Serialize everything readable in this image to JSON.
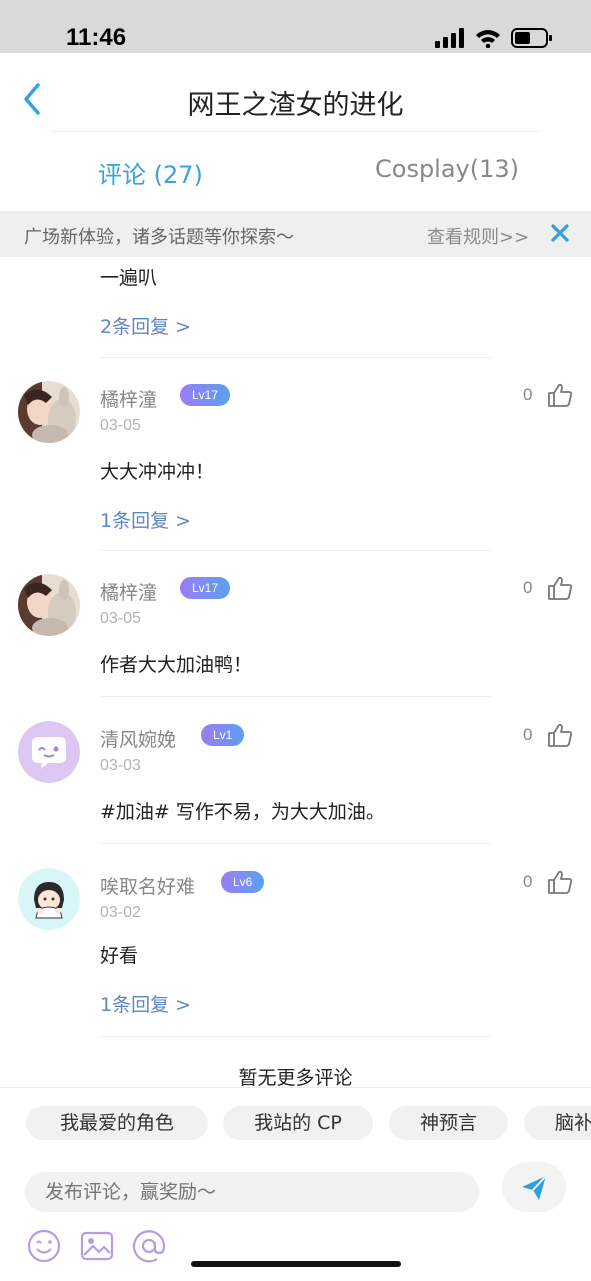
{
  "status_bar": {
    "time": "11:46"
  },
  "header": {
    "title": "网王之渣女的进化"
  },
  "tabs": [
    {
      "label": "评论 (27)",
      "active": true
    },
    {
      "label": "Cosplay(13)",
      "active": false
    }
  ],
  "notice": {
    "text": "广场新体验，诸多话题等你探索～",
    "link": "查看规则>>"
  },
  "partial_comment": {
    "text": "一遍叭",
    "replies": "2条回复 >"
  },
  "comments": [
    {
      "user": "橘梓潼",
      "level": "Lv17",
      "date": "03-05",
      "text": "大大冲冲冲！",
      "likes": "0",
      "replies": "1条回复 >"
    },
    {
      "user": "橘梓潼",
      "level": "Lv17",
      "date": "03-05",
      "text": "作者大大加油鸭！",
      "likes": "0",
      "replies": ""
    },
    {
      "user": "清风婉娩",
      "level": "Lv1",
      "date": "03-03",
      "text": "#加油# 写作不易，为大大加油。",
      "likes": "0",
      "replies": ""
    },
    {
      "user": "唉取名好难",
      "level": "Lv6",
      "date": "03-02",
      "text": "好看",
      "likes": "0",
      "replies": "1条回复 >"
    }
  ],
  "footer_note": "暂无更多评论",
  "quick_tags": [
    "我最爱的角色",
    "我站的 CP",
    "神预言",
    "脑补"
  ],
  "composer": {
    "placeholder": "发布评论，赢奖励～"
  },
  "colors": {
    "accent": "#34a3e0",
    "link": "#5e86c2",
    "badge_start": "#9b7df5",
    "badge_end": "#5aa0f0"
  },
  "icons": [
    "back-icon",
    "close-icon",
    "thumbs-up-icon",
    "send-icon",
    "emoji-icon",
    "image-icon",
    "mention-icon"
  ]
}
